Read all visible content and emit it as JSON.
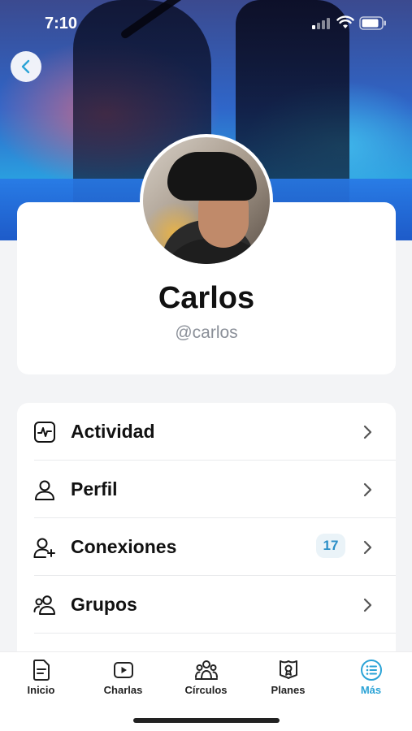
{
  "status_bar": {
    "time": "7:10"
  },
  "profile": {
    "name": "Carlos",
    "handle": "@carlos"
  },
  "menu": {
    "items": [
      {
        "label": "Actividad",
        "icon": "activity-icon"
      },
      {
        "label": "Perfil",
        "icon": "user-icon"
      },
      {
        "label": "Conexiones",
        "icon": "user-plus-icon",
        "badge": "17"
      },
      {
        "label": "Grupos",
        "icon": "users-icon"
      }
    ]
  },
  "tabbar": {
    "tabs": [
      {
        "label": "Inicio",
        "icon": "document-icon",
        "active": false
      },
      {
        "label": "Charlas",
        "icon": "play-icon",
        "active": false
      },
      {
        "label": "Círculos",
        "icon": "group-icon",
        "active": false
      },
      {
        "label": "Planes",
        "icon": "plans-icon",
        "active": false
      },
      {
        "label": "Más",
        "icon": "list-icon",
        "active": true
      }
    ]
  },
  "colors": {
    "accent": "#2ba3d6",
    "badge_bg": "#eaf3f8",
    "badge_text": "#2c8fc7"
  }
}
